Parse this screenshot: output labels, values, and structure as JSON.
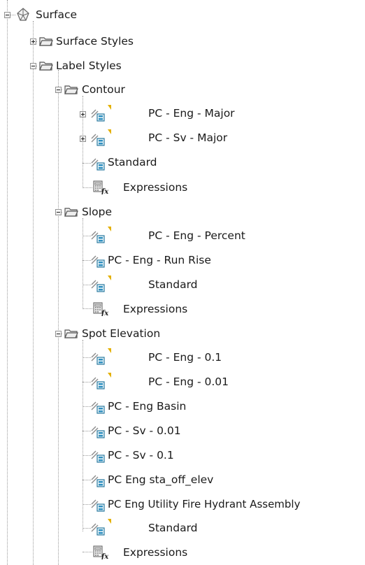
{
  "tree": {
    "root": {
      "label": "Surface",
      "icon": "surface-icon"
    },
    "surface_styles": {
      "label": "Surface Styles",
      "icon": "folder-icon"
    },
    "label_styles": {
      "label": "Label Styles",
      "icon": "folder-open-icon"
    },
    "contour": {
      "label": "Contour",
      "items": [
        {
          "label": "PC - Eng - Major",
          "icon": "label-style-icon"
        },
        {
          "label": "PC - Sv - Major",
          "icon": "label-style-icon"
        },
        {
          "label": "Standard",
          "icon": "label-style-icon"
        },
        {
          "label": "Expressions",
          "icon": "expressions-icon"
        }
      ]
    },
    "slope": {
      "label": "Slope",
      "items": [
        {
          "label": "PC - Eng - Percent",
          "icon": "label-style-icon"
        },
        {
          "label": "PC - Eng - Run Rise",
          "icon": "label-style-icon"
        },
        {
          "label": "Standard",
          "icon": "label-style-icon"
        },
        {
          "label": "Expressions",
          "icon": "expressions-icon"
        }
      ]
    },
    "spot_elevation": {
      "label": "Spot Elevation",
      "items": [
        {
          "label": "PC - Eng - 0.1",
          "icon": "label-style-icon"
        },
        {
          "label": "PC - Eng - 0.01",
          "icon": "label-style-icon"
        },
        {
          "label": "PC - Eng Basin",
          "icon": "label-style-icon"
        },
        {
          "label": "PC - Sv - 0.01",
          "icon": "label-style-icon"
        },
        {
          "label": "PC - Sv - 0.1",
          "icon": "label-style-icon"
        },
        {
          "label": "PC Eng sta_off_elev",
          "icon": "label-style-icon"
        },
        {
          "label": "PC Eng Utility Fire Hydrant Assembly",
          "icon": "label-style-icon"
        },
        {
          "label": "Standard",
          "icon": "label-style-icon"
        },
        {
          "label": "Expressions",
          "icon": "expressions-icon"
        }
      ]
    }
  }
}
